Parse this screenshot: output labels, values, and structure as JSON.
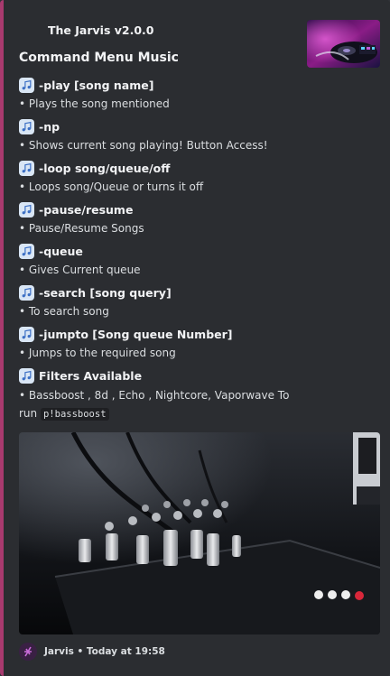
{
  "embed": {
    "accent_color": "#a83a6e",
    "author": "The Jarvis v2.0.0",
    "title": "Command Menu Music",
    "thumbnail_icon": "dj-turntable-image",
    "fields": [
      {
        "icon": "musical-note-icon",
        "name": "-play [song name]",
        "value": "• Plays the song mentioned"
      },
      {
        "icon": "musical-note-icon",
        "name": "-np",
        "value": "• Shows current song playing! Button Access!"
      },
      {
        "icon": "musical-note-icon",
        "name": "-loop song/queue/off",
        "value": "• Loops song/Queue or turns it off"
      },
      {
        "icon": "musical-note-icon",
        "name": "-pause/resume",
        "value": "• Pause/Resume Songs"
      },
      {
        "icon": "musical-note-icon",
        "name": "-queue",
        "value": "• Gives Current queue"
      },
      {
        "icon": "musical-note-icon",
        "name": "-search [song query]",
        "value": "• To search song"
      },
      {
        "icon": "musical-note-icon",
        "name": "-jumpto [Song queue Number]",
        "value": "• Jumps to the required song"
      }
    ],
    "filters": {
      "icon": "musical-note-icon",
      "name": "Filters Available",
      "value": "• Bassboost , 8d , Echo , Nightcore, Vaporwave To run",
      "code": "p!bassboost"
    },
    "image_icon": "audio-mixer-image",
    "footer": {
      "icon": "jarvis-avatar-icon",
      "text": "Jarvis • Today at 19:58"
    }
  }
}
